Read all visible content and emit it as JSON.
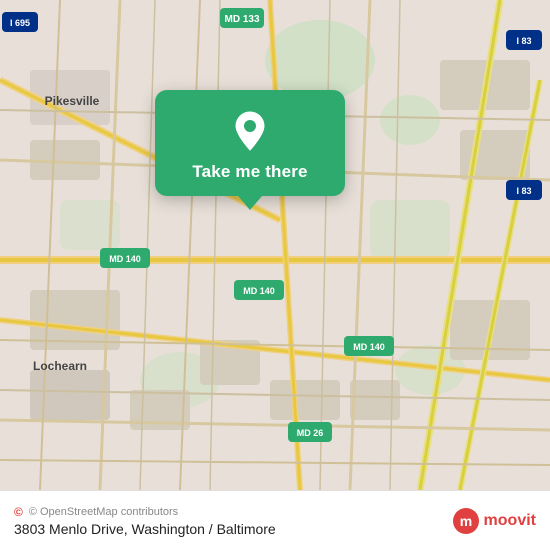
{
  "map": {
    "background_color": "#e8e0d8",
    "popup": {
      "button_label": "Take me there",
      "background_color": "#2eaa6e"
    }
  },
  "bottom_bar": {
    "osm_attribution": "© OpenStreetMap contributors",
    "address": "3803 Menlo Drive, Washington / Baltimore",
    "moovit_brand": "moovit"
  },
  "icons": {
    "pin": "location-pin-icon",
    "moovit_logo": "moovit-brand-icon"
  }
}
